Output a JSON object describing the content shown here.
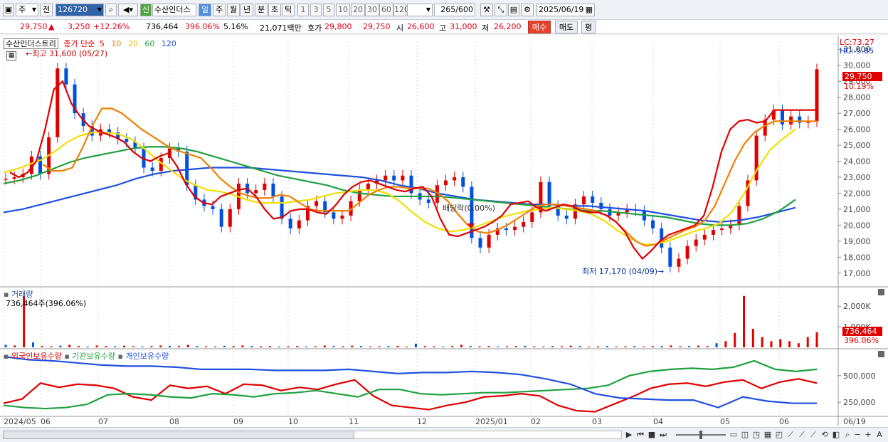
{
  "toolbar": {
    "type_select": "주",
    "prev_label": "전",
    "code": "126720",
    "stock_name": "수산인더스",
    "badge_new": "신",
    "periods": [
      "일",
      "주",
      "월",
      "년",
      "분",
      "초",
      "틱"
    ],
    "active_period": "일",
    "intervals": [
      "1",
      "3",
      "5",
      "10",
      "20",
      "30",
      "60",
      "120"
    ],
    "count": "265",
    "count_max": "/600",
    "date": "2025/06/19"
  },
  "price": {
    "current": "29,750",
    "arrow": "▲",
    "change": "3,250",
    "change_pct": "+12.26%",
    "volume": "736,464",
    "volume_ratio": "396.06%",
    "turnover": "5.16%",
    "amount": "21,071백만",
    "hoga_label": "호가",
    "ask": "29,800",
    "bid": "29,750",
    "open_label": "시",
    "open": "26,600",
    "high_label": "고",
    "high": "31,000",
    "low_label": "저",
    "low": "26,200",
    "buy_label": "매수",
    "sell_label": "매도",
    "eval_label": "평"
  },
  "chart_data": {
    "type": "line",
    "title": "수산인더스트리",
    "price_legend": {
      "label": "종가 단순",
      "periods": [
        "5",
        "10",
        "20",
        "60",
        "120"
      ],
      "colors": [
        "#e00000",
        "#f08000",
        "#f0e000",
        "#20a040",
        "#2050e0"
      ]
    },
    "x_labels": [
      "2024/05",
      "06",
      "07",
      "08",
      "09",
      "10",
      "11",
      "12",
      "2025/01",
      "02",
      "03",
      "04",
      "05",
      "06",
      "06/19"
    ],
    "y_ticks": [
      "31,000",
      "30,000",
      "29,000",
      "28,000",
      "27,000",
      "26,000",
      "25,000",
      "24,000",
      "23,000",
      "22,000",
      "21,000",
      "20,000",
      "19,000",
      "18,000",
      "17,000"
    ],
    "ylim": [
      16500,
      31500
    ],
    "lc": "LC:73.27",
    "hc": "HC:-5.85",
    "last_price": "29,750",
    "last_pct": "10.19%",
    "high_annotation": "최고 31,600 (05/27)",
    "low_annotation": "최저 17,170 (04/09)",
    "dividend_annotation": "배당락(0.00%)",
    "close": [
      22.9,
      23.0,
      23.2,
      24.3,
      23.2,
      25.5,
      29.8,
      28.8,
      27.0,
      26.2,
      25.6,
      26.0,
      25.8,
      25.4,
      25.2,
      24.8,
      23.6,
      23.4,
      24.2,
      24.8,
      24.6,
      22.5,
      21.6,
      21.2,
      21.0,
      19.9,
      21.0,
      22.6,
      22.0,
      22.2,
      22.6,
      21.8,
      20.4,
      19.8,
      20.3,
      21.2,
      21.5,
      20.8,
      20.4,
      20.6,
      21.5,
      22.2,
      22.6,
      22.8,
      23.1,
      22.8,
      23.1,
      22.0,
      21.6,
      21.4,
      22.5,
      22.8,
      23.0,
      22.4,
      19.2,
      18.6,
      19.4,
      19.8,
      19.7,
      19.9,
      20.2,
      20.8,
      22.7,
      21.2,
      20.6,
      20.4,
      21.3,
      21.8,
      21.4,
      21.0,
      20.6,
      20.8,
      21.0,
      20.9,
      20.3,
      19.8,
      18.6,
      17.4,
      17.9,
      18.7,
      19.1,
      19.4,
      19.7,
      19.8,
      20.0,
      21.2,
      22.8,
      25.6,
      26.6,
      27.2,
      26.3,
      26.8,
      26.4,
      26.5,
      29.75
    ],
    "ma5": [
      23.3,
      23.0,
      23.3,
      24.0,
      26.0,
      28.5,
      29.0,
      27.6,
      26.8,
      26.2,
      25.9,
      25.7,
      25.5,
      25.2,
      24.6,
      24.2,
      24.0,
      24.3,
      24.5,
      23.7,
      22.6,
      21.8,
      21.4,
      21.3,
      21.8,
      22.0,
      22.2,
      22.3,
      21.8,
      21.0,
      20.4,
      20.5,
      20.9,
      21.0,
      21.0,
      20.8,
      20.7,
      21.2,
      21.9,
      22.4,
      22.7,
      22.8,
      22.6,
      22.4,
      22.2,
      22.1,
      22.3,
      22.4,
      21.8,
      20.4,
      19.4,
      19.3,
      19.5,
      19.7,
      19.9,
      20.2,
      20.6,
      21.3,
      21.4,
      21.5,
      21.1,
      20.9,
      21.1,
      21.3,
      21.2,
      20.9,
      20.8,
      20.8,
      20.6,
      20.2,
      19.6,
      18.6,
      17.9,
      18.4,
      19.0,
      19.4,
      19.6,
      19.8,
      20.0,
      20.6,
      22.4,
      24.6,
      26.0,
      26.5,
      26.6,
      26.4,
      26.5,
      27.2
    ],
    "ma10": [
      23.8,
      23.4,
      23.4,
      23.6,
      24.8,
      26.2,
      27.3,
      27.3,
      27.0,
      26.5,
      26.0,
      25.6,
      25.2,
      24.8,
      24.6,
      24.4,
      24.2,
      23.6,
      22.9,
      22.4,
      22.0,
      21.8,
      21.7,
      21.7,
      21.9,
      21.8,
      21.4,
      21.0,
      20.9,
      20.9,
      20.9,
      20.9,
      21.4,
      21.9,
      22.2,
      22.4,
      22.4,
      22.3,
      22.3,
      22.3,
      22.0,
      21.5,
      20.7,
      20.0,
      19.6,
      19.5,
      19.7,
      20.0,
      20.4,
      20.8,
      21.2,
      21.3,
      21.3,
      21.2,
      21.1,
      21.0,
      20.9,
      20.6,
      20.2,
      19.6,
      19.0,
      18.7,
      18.8,
      19.1,
      19.4,
      19.7,
      19.9,
      20.3,
      21.2,
      22.6,
      24.0,
      25.1,
      25.8,
      26.2,
      26.5
    ],
    "ma20": [
      23.3,
      23.5,
      23.8,
      24.1,
      24.6,
      25.2,
      25.6,
      25.8,
      25.8,
      25.7,
      25.4,
      24.8,
      24.1,
      23.5,
      22.9,
      22.5,
      22.2,
      22.1,
      21.9,
      21.6,
      21.4,
      21.4,
      21.4,
      21.5,
      21.6,
      21.8,
      22.0,
      22.1,
      22.2,
      22.2,
      22.0,
      21.5,
      20.8,
      20.2,
      19.8,
      19.6,
      19.7,
      19.9,
      20.2,
      20.5,
      20.7,
      20.9,
      21.0,
      21.1,
      21.0,
      20.9,
      20.7,
      20.3,
      19.7,
      19.2,
      18.8,
      18.8,
      19.0,
      19.3,
      19.6,
      19.8,
      20.1,
      20.8,
      22.0,
      23.5,
      24.7,
      25.4,
      26.0
    ],
    "ma60": [
      22.6,
      22.8,
      23.1,
      23.5,
      23.9,
      24.2,
      24.4,
      24.6,
      24.8,
      24.9,
      24.9,
      24.8,
      24.6,
      24.3,
      24.0,
      23.7,
      23.4,
      23.1,
      22.9,
      22.7,
      22.5,
      22.2,
      22.0,
      21.9,
      21.8,
      21.8,
      21.8,
      21.8,
      21.7,
      21.6,
      21.5,
      21.4,
      21.3,
      21.2,
      21.1,
      21.0,
      20.9,
      20.9,
      20.8,
      20.7,
      20.6,
      20.5,
      20.3,
      20.1,
      20.0,
      20.0,
      20.1,
      20.4,
      20.9,
      21.6
    ],
    "ma120": [
      20.8,
      21.0,
      21.3,
      21.6,
      21.9,
      22.2,
      22.5,
      22.9,
      23.2,
      23.4,
      23.5,
      23.6,
      23.6,
      23.6,
      23.5,
      23.4,
      23.3,
      23.2,
      23.1,
      23.0,
      22.8,
      22.5,
      22.3,
      22.0,
      21.8,
      21.6,
      21.5,
      21.4,
      21.3,
      21.3,
      21.2,
      21.2,
      21.1,
      21.0,
      20.9,
      20.7,
      20.5,
      20.3,
      20.2,
      20.3,
      20.5,
      20.8,
      21.1
    ],
    "volume": {
      "label": "거래량",
      "value_label": "736,464주(396.06%)",
      "y_ticks": [
        "2,000K",
        "1,000K"
      ],
      "last_value": "736,464",
      "last_pct": "396.06%",
      "bars_k": [
        120,
        90,
        2500,
        240,
        60,
        50,
        80,
        120,
        60,
        40,
        90,
        60,
        50,
        80,
        50,
        40,
        60,
        90,
        70,
        60,
        120,
        60,
        50,
        40,
        70,
        60,
        90,
        60,
        50,
        60,
        40,
        50,
        60,
        40,
        50,
        90,
        60,
        50,
        80,
        60,
        40,
        50,
        60,
        70,
        40,
        180,
        60,
        50,
        40,
        60,
        120,
        60,
        50,
        60,
        40,
        50,
        60,
        70,
        50,
        40,
        60,
        50,
        80,
        60,
        40,
        50,
        60,
        40,
        50,
        60,
        40,
        50,
        60,
        90,
        50,
        60,
        80,
        60,
        200,
        300,
        700,
        2500,
        900,
        500,
        300,
        400,
        300,
        200,
        500,
        736
      ]
    },
    "holdings": {
      "series": [
        {
          "name": "외국인보유수량",
          "color": "#e00000",
          "values": [
            240,
            280,
            430,
            390,
            420,
            410,
            380,
            300,
            270,
            410,
            380,
            400,
            330,
            420,
            410,
            360,
            390,
            370,
            420,
            460,
            310,
            220,
            200,
            180,
            220,
            250,
            300,
            310,
            330,
            310,
            220,
            170,
            160,
            230,
            300,
            380,
            420,
            430,
            400,
            440,
            460,
            380,
            440,
            470,
            430
          ]
        },
        {
          "name": "기관보유수량",
          "color": "#20a040",
          "values": [
            220,
            200,
            190,
            200,
            230,
            320,
            330,
            320,
            300,
            290,
            330,
            320,
            300,
            330,
            340,
            360,
            330,
            300,
            370,
            370,
            330,
            320,
            330,
            340,
            340,
            350,
            360,
            370,
            380,
            410,
            500,
            540,
            560,
            570,
            560,
            580,
            640,
            560,
            540,
            560
          ]
        },
        {
          "name": "개인보유수량",
          "color": "#2050e0",
          "values": [
            680,
            650,
            640,
            620,
            600,
            590,
            590,
            580,
            560,
            560,
            560,
            550,
            550,
            550,
            560,
            540,
            520,
            530,
            530,
            540,
            530,
            510,
            470,
            420,
            330,
            290,
            280,
            270,
            270,
            200,
            300,
            260,
            240,
            240
          ]
        }
      ],
      "y_ticks": [
        "500,000",
        "250,000"
      ]
    }
  },
  "scroll": {
    "icons": [
      "▶",
      "⏮",
      "■",
      "⏭",
      "−",
      "+",
      "A"
    ]
  }
}
